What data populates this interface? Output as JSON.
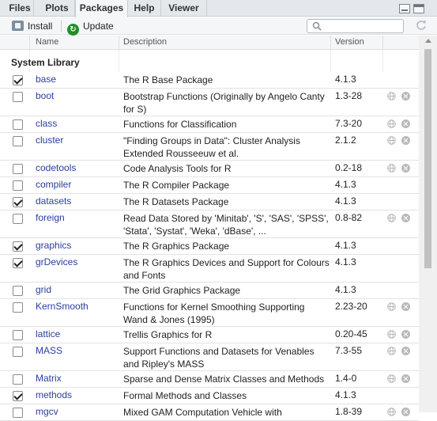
{
  "tabs": [
    {
      "label": "Files"
    },
    {
      "label": "Plots"
    },
    {
      "label": "Packages"
    },
    {
      "label": "Help"
    },
    {
      "label": "Viewer"
    }
  ],
  "active_tab": "Packages",
  "toolbar": {
    "install_label": "Install",
    "update_label": "Update",
    "search_placeholder": ""
  },
  "columns": {
    "name": "Name",
    "description": "Description",
    "version": "Version"
  },
  "section_title": "System Library",
  "packages": [
    {
      "checked": true,
      "name": "base",
      "desc": [
        "The R Base Package"
      ],
      "version": "4.1.3",
      "actions": false
    },
    {
      "checked": false,
      "name": "boot",
      "desc": [
        "Bootstrap Functions (Originally by Angelo Canty",
        "for S)"
      ],
      "version": "1.3-28",
      "actions": true
    },
    {
      "checked": false,
      "name": "class",
      "desc": [
        "Functions for Classification"
      ],
      "version": "7.3-20",
      "actions": true
    },
    {
      "checked": false,
      "name": "cluster",
      "desc": [
        "\"Finding Groups in Data\": Cluster Analysis",
        "Extended Rousseeuw et al."
      ],
      "version": "2.1.2",
      "actions": true
    },
    {
      "checked": false,
      "name": "codetools",
      "desc": [
        "Code Analysis Tools for R"
      ],
      "version": "0.2-18",
      "actions": true
    },
    {
      "checked": false,
      "name": "compiler",
      "desc": [
        "The R Compiler Package"
      ],
      "version": "4.1.3",
      "actions": false
    },
    {
      "checked": true,
      "name": "datasets",
      "desc": [
        "The R Datasets Package"
      ],
      "version": "4.1.3",
      "actions": false
    },
    {
      "checked": false,
      "name": "foreign",
      "desc": [
        "Read Data Stored by 'Minitab', 'S', 'SAS', 'SPSS',",
        "'Stata', 'Systat', 'Weka', 'dBase', ..."
      ],
      "version": "0.8-82",
      "actions": true
    },
    {
      "checked": true,
      "name": "graphics",
      "desc": [
        "The R Graphics Package"
      ],
      "version": "4.1.3",
      "actions": false
    },
    {
      "checked": true,
      "name": "grDevices",
      "desc": [
        "The R Graphics Devices and Support for Colours",
        "and Fonts"
      ],
      "version": "4.1.3",
      "actions": false
    },
    {
      "checked": false,
      "name": "grid",
      "desc": [
        "The Grid Graphics Package"
      ],
      "version": "4.1.3",
      "actions": false
    },
    {
      "checked": false,
      "name": "KernSmooth",
      "desc": [
        "Functions for Kernel Smoothing Supporting",
        "Wand & Jones (1995)"
      ],
      "version": "2.23-20",
      "actions": true
    },
    {
      "checked": false,
      "name": "lattice",
      "desc": [
        "Trellis Graphics for R"
      ],
      "version": "0.20-45",
      "actions": true
    },
    {
      "checked": false,
      "name": "MASS",
      "desc": [
        "Support Functions and Datasets for Venables",
        "and Ripley's MASS"
      ],
      "version": "7.3-55",
      "actions": true
    },
    {
      "checked": false,
      "name": "Matrix",
      "desc": [
        "Sparse and Dense Matrix Classes and Methods"
      ],
      "version": "1.4-0",
      "actions": true
    },
    {
      "checked": true,
      "name": "methods",
      "desc": [
        "Formal Methods and Classes"
      ],
      "version": "4.1.3",
      "actions": false
    },
    {
      "checked": false,
      "name": "mgcv",
      "desc": [
        "Mixed GAM Computation Vehicle with"
      ],
      "version": "1.8-39",
      "actions": true
    }
  ]
}
